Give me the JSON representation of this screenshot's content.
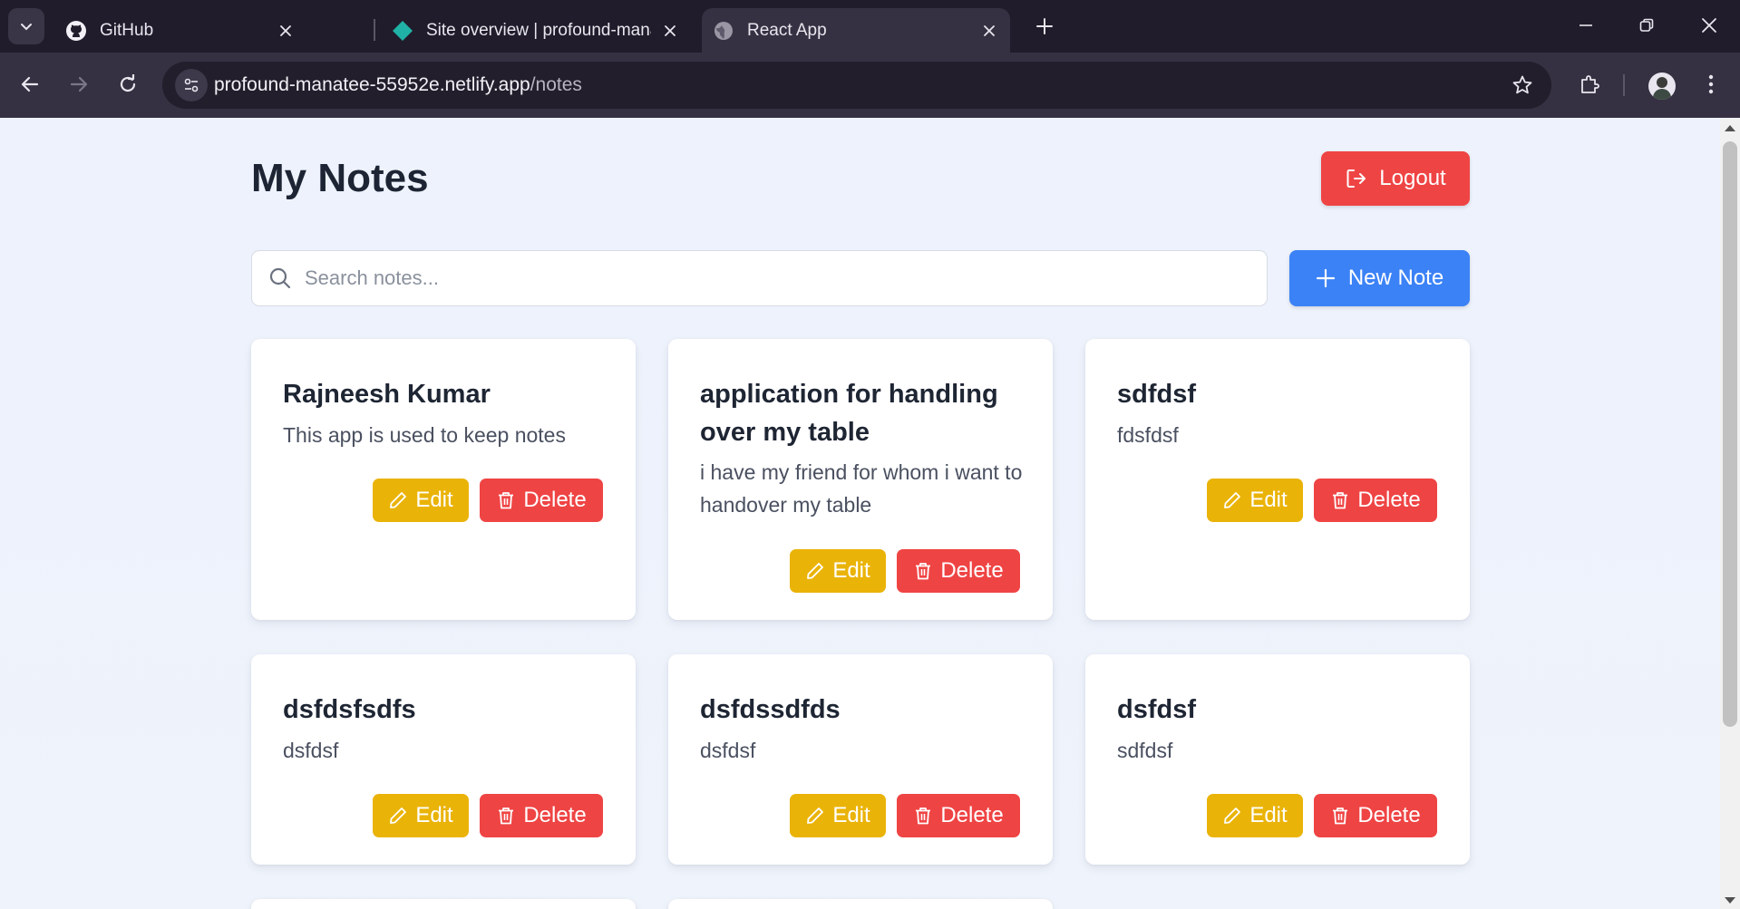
{
  "browser": {
    "tabs": [
      {
        "title": "GitHub",
        "favicon": "github-icon",
        "active": false
      },
      {
        "title": "Site overview | profound-manat",
        "favicon": "netlify-icon",
        "active": false
      },
      {
        "title": "React App",
        "favicon": "globe-icon",
        "active": true
      }
    ],
    "address": {
      "host": "profound-manatee-55952e.netlify.app",
      "path": "/notes"
    }
  },
  "page": {
    "title": "My Notes",
    "logout_label": "Logout",
    "search": {
      "placeholder": "Search notes...",
      "value": ""
    },
    "new_note_label": "New Note",
    "edit_label": "Edit",
    "delete_label": "Delete",
    "notes": [
      {
        "title": "Rajneesh Kumar",
        "body": "This app is used to keep notes"
      },
      {
        "title": "application for handling over my table",
        "body": "i have my friend for whom i want to handover my table"
      },
      {
        "title": "sdfdsf",
        "body": "fdsfdsf"
      },
      {
        "title": "dsfdsfsdfs",
        "body": "dsfdsf"
      },
      {
        "title": "dsfdssdfds",
        "body": "dsfdsf"
      },
      {
        "title": "dsfdsf",
        "body": "sdfdsf"
      }
    ]
  },
  "colors": {
    "logout": "#ef4444",
    "new_note": "#3b82f6",
    "edit": "#eab308",
    "delete": "#ef4444",
    "background": "#eef3fb"
  }
}
